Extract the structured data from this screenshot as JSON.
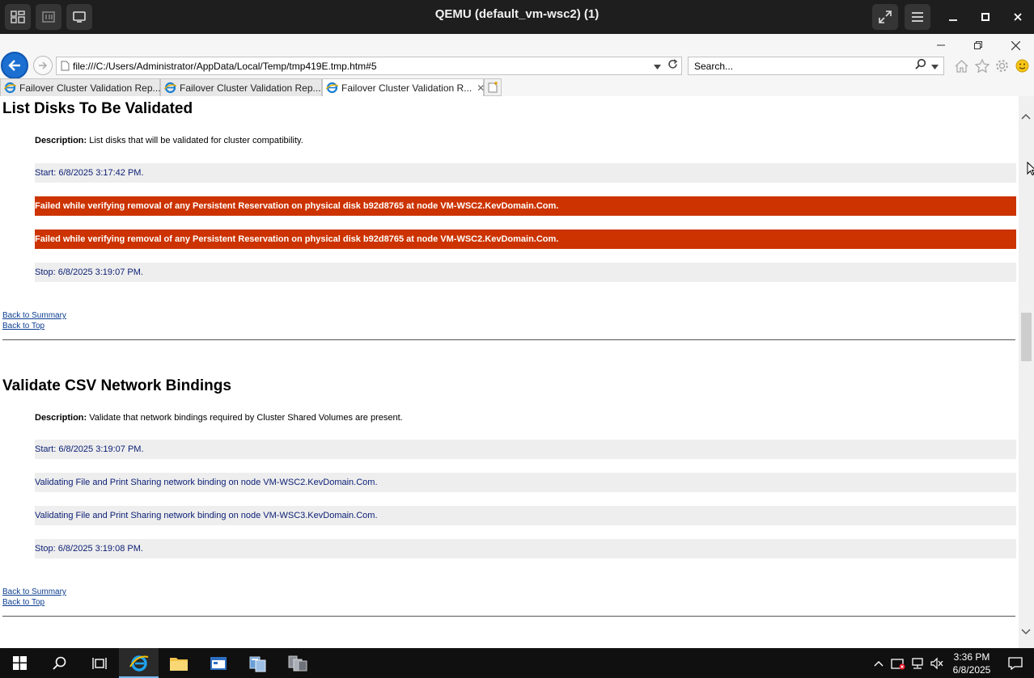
{
  "qemu": {
    "title": "QEMU (default_vm-wsc2) (1)"
  },
  "browser": {
    "url": "file:///C:/Users/Administrator/AppData/Local/Temp/tmp419E.tmp.htm#5",
    "search_placeholder": "Search...",
    "tabs": [
      {
        "label": "Failover Cluster Validation Rep..."
      },
      {
        "label": "Failover Cluster Validation Rep..."
      },
      {
        "label": "Failover Cluster Validation R...",
        "close": "✕"
      }
    ]
  },
  "sections": [
    {
      "title": "List Disks To Be Validated",
      "description_label": "Description:",
      "description": "List disks that will be validated for cluster compatibility.",
      "rows": [
        {
          "text": "Start: 6/8/2025 3:17:42 PM.",
          "status": "info"
        },
        {
          "text": "Failed while verifying removal of any Persistent Reservation on physical disk b92d8765 at node VM-WSC2.KevDomain.Com.",
          "status": "error"
        },
        {
          "text": "Failed while verifying removal of any Persistent Reservation on physical disk b92d8765 at node VM-WSC2.KevDomain.Com.",
          "status": "error"
        },
        {
          "text": "Stop: 6/8/2025 3:19:07 PM.",
          "status": "info"
        }
      ],
      "back_to_summary": "Back to Summary",
      "back_to_top": "Back to Top"
    },
    {
      "title": "Validate CSV Network Bindings",
      "description_label": "Description:",
      "description": "Validate that network bindings required by Cluster Shared Volumes are present.",
      "rows": [
        {
          "text": "Start: 6/8/2025 3:19:07 PM.",
          "status": "info"
        },
        {
          "text": "Validating File and Print Sharing network binding on node VM-WSC2.KevDomain.Com.",
          "status": "info"
        },
        {
          "text": "Validating File and Print Sharing network binding on node VM-WSC3.KevDomain.Com.",
          "status": "info"
        },
        {
          "text": "Stop: 6/8/2025 3:19:08 PM.",
          "status": "info"
        }
      ],
      "back_to_summary": "Back to Summary",
      "back_to_top": "Back to Top"
    }
  ],
  "taskbar": {
    "time": "3:36 PM",
    "date": "6/8/2025"
  },
  "colors": {
    "error_row": "#cc3300",
    "info_row": "#eeeeee",
    "info_text": "#0a1e75",
    "ie_blue": "#1b6fd0"
  }
}
